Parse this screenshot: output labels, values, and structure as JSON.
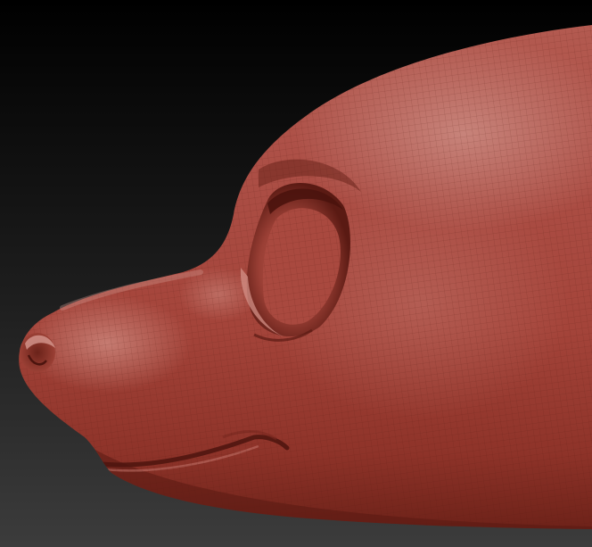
{
  "scene": {
    "subject": "sculpted-animal-head-profile",
    "material_color": "#a8453c",
    "material_highlight": "#c98a82",
    "material_shadow": "#5e1d17",
    "background_top": "#000000",
    "background_bottom": "#3b3b3b",
    "wireframe_visible": true
  }
}
